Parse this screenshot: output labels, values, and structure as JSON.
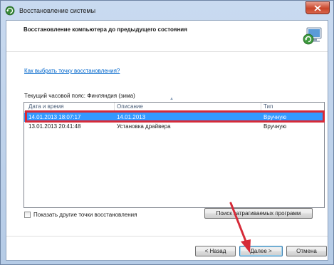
{
  "window": {
    "title": "Восстановление системы"
  },
  "header": {
    "title": "Восстановление компьютера до предыдущего состояния"
  },
  "help_link": "Как выбрать точку восстановления?",
  "timezone_label": "Текущий часовой пояс: Финляндия (зима)",
  "list": {
    "columns": [
      "Дата и время",
      "Описание",
      "Тип"
    ],
    "rows": [
      {
        "date": "14.01.2013 18:07:17",
        "description": "14.01.2013",
        "type": "Вручную",
        "selected": true
      },
      {
        "date": "13.01.2013 20:41:48",
        "description": "Установка драйвера",
        "type": "Вручную",
        "selected": false
      }
    ]
  },
  "checkbox": {
    "label": "Показать другие точки восстановления",
    "checked": false
  },
  "buttons": {
    "scan": "Поиск затрагиваемых программ",
    "back": "< Назад",
    "next": "Далее >",
    "cancel": "Отмена"
  },
  "colors": {
    "selection": "#3399ff",
    "highlight": "#d62a38",
    "link": "#0066cc"
  }
}
